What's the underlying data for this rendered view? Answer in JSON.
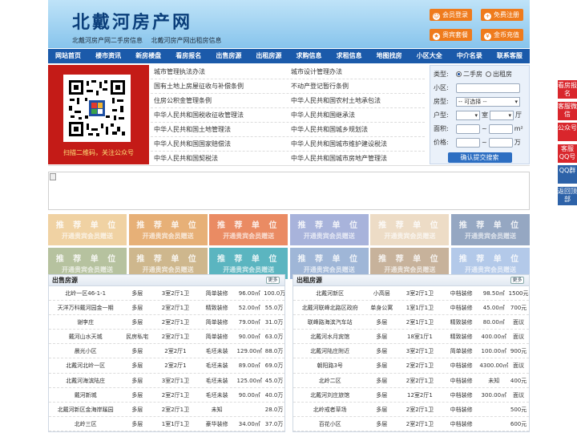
{
  "header": {
    "logo": "北戴河房产网",
    "sublinks": [
      "北戴河房产网二手房信息",
      "北戴河房产网出租房信息"
    ],
    "buttons": [
      {
        "label": "会员登录",
        "icon": "user-icon"
      },
      {
        "label": "免费注册",
        "icon": "register-icon"
      },
      {
        "label": "贵宾套餐",
        "icon": "vip-icon"
      },
      {
        "label": "金币充值",
        "icon": "coin-icon"
      }
    ]
  },
  "nav": [
    "网站首页",
    "楼市资讯",
    "新房楼盘",
    "看房报名",
    "出售房源",
    "出租房源",
    "求购信息",
    "求租信息",
    "地图找房",
    "小区大全",
    "中介名录",
    "联系客服"
  ],
  "qr": {
    "caption": "扫描二维码，关注公众号"
  },
  "links": {
    "left": [
      "城市管理执法办法",
      "国有土地上房屋征收与补偿条例",
      "住房公积金管理条例",
      "中华人民共和国税收征收管理法",
      "中华人民共和国土地管理法",
      "中华人民共和国国家赔偿法",
      "中华人民共和国契税法"
    ],
    "right": [
      "城市设计管理办法",
      "不动产登记暂行条例",
      "中华人民共和国农村土地承包法",
      "中华人民共和国继承法",
      "中华人民共和国城乡规划法",
      "中华人民共和国城市维护建设税法",
      "中华人民共和国城市房地产管理法"
    ]
  },
  "search": {
    "type_label": "类型:",
    "type_options": [
      "二手房",
      "出租房"
    ],
    "community_label": "小区:",
    "house_label": "房型:",
    "house_select": "-- 可选择 --",
    "layout_label": "户型:",
    "room_unit": "室",
    "hall_unit": "厅",
    "area_label": "面积:",
    "area_unit": "m²",
    "price_label": "价格:",
    "price_unit": "万",
    "range_sep": "~",
    "submit": "确认提交搜索"
  },
  "recommend": {
    "title": "推 荐 单 位",
    "subtitle": "开通贵宾会员赠送",
    "colors": [
      "#f0d2a3",
      "#e7b077",
      "#ea8b63",
      "#a8b3db",
      "#eddcc6",
      "#95a7c2",
      "#b6c29f",
      "#ceb78d",
      "#5bb5c0",
      "#9fb6d7",
      "#c7b29b",
      "#b3c9e9"
    ]
  },
  "sale": {
    "title": "出售房源",
    "more": "更多",
    "rows": [
      [
        "北岭一区46-1-1",
        "多层",
        "3室2厅1卫",
        "简单装修",
        "96.00㎡",
        "100.0万"
      ],
      [
        "天洋万科戴河园金一期",
        "多层",
        "2室2厅1卫",
        "精致装修",
        "52.00㎡",
        "55.0万"
      ],
      [
        "谢李庄",
        "多层",
        "2室2厅1卫",
        "简单装修",
        "79.00㎡",
        "31.0万"
      ],
      [
        "戴河山水天城",
        "民房私宅",
        "2室2厅1卫",
        "简单装修",
        "90.00㎡",
        "63.0万"
      ],
      [
        "晨光小区",
        "多层",
        "2室2厅1",
        "毛坯未装",
        "129.00㎡",
        "88.0万"
      ],
      [
        "北戴河北岭一区",
        "多层",
        "2室2厅1",
        "毛坯未装",
        "89.00㎡",
        "69.0万"
      ],
      [
        "北戴河海滨陆庄",
        "多层",
        "3室2厅1卫",
        "毛坯未装",
        "125.00㎡",
        "45.0万"
      ],
      [
        "戴河新城",
        "多层",
        "2室2厅1卫",
        "毛坯未装",
        "90.00㎡",
        "40.0万"
      ],
      [
        "北戴河新区金海岸蹊园",
        "多层",
        "2室2厅1卫",
        "未知",
        "",
        "28.0万"
      ],
      [
        "北岭三区",
        "多层",
        "1室1厅1卫",
        "豪华装修",
        "34.00㎡",
        "37.0万"
      ]
    ]
  },
  "rent": {
    "title": "出租房源",
    "more": "更多",
    "rows": [
      [
        "北戴河新区",
        "小高层",
        "3室2厅1卫",
        "中档装修",
        "98.50㎡",
        "1500元"
      ],
      [
        "北戴河联峰北路区政府",
        "单身公寓",
        "1室1厅1卫",
        "中档装修",
        "45.00㎡",
        "700元"
      ],
      [
        "联峰路海滨汽车站",
        "多层",
        "2室1厅1卫",
        "精致装修",
        "80.00㎡",
        "面议"
      ],
      [
        "北戴河水月宾馆",
        "多层",
        "18室1厅1",
        "精致装修",
        "400.00㎡",
        "面议"
      ],
      [
        "北戴河陆庄附近",
        "多层",
        "3室2厅1卫",
        "简单装修",
        "100.00㎡",
        "900元"
      ],
      [
        "朝阳路3号",
        "多层",
        "2室2厅1卫",
        "中档装修",
        "4300.00㎡",
        "面议"
      ],
      [
        "北岭二区",
        "多层",
        "2室2厅1卫",
        "中档装修",
        "未知",
        "400元"
      ],
      [
        "北戴河刘庄旅馆",
        "多层",
        "12室2厅1",
        "中档装修",
        "300.00㎡",
        "面议"
      ],
      [
        "北岭戒者草场",
        "多层",
        "2室2厅1卫",
        "中档装修",
        "",
        "500元"
      ],
      [
        "百花小区",
        "多层",
        "2室2厅1卫",
        "中档装修",
        "",
        "600元"
      ]
    ]
  },
  "side": [
    "看房报名",
    "客服微信",
    "公众号",
    "客服QQ号",
    "QQ群",
    "返回顶部"
  ]
}
